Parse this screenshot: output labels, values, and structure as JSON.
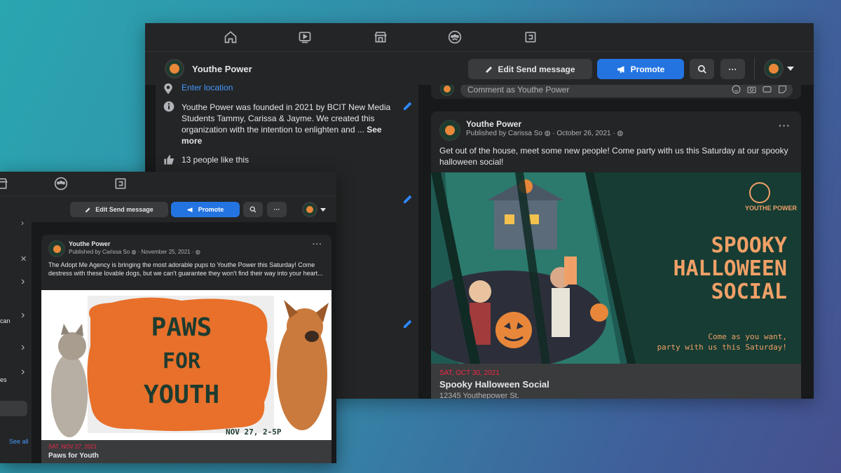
{
  "colors": {
    "fb_blue": "#2374e1",
    "bg_dark": "#18191a",
    "card": "#242526",
    "link": "#4599ff",
    "event_date": "#f02849",
    "event_bg": "#163c33",
    "event_title": "#f0a067"
  },
  "nav_icons": [
    "home-icon",
    "watch-icon",
    "marketplace-icon",
    "groups-icon",
    "gaming-icon"
  ],
  "page": {
    "name": "Youthe Power"
  },
  "buttons": {
    "edit_send": "Edit Send message",
    "promote": "Promote"
  },
  "about": {
    "location": "Enter location",
    "description": "Youthe Power was founded in 2021 by BCIT New Media Students Tammy, Carissa & Jayme. We created this organization with the intention to enlighten and ...",
    "see_more": "See more",
    "likes": "13 people like this"
  },
  "comment_placeholder": "Comment as Youthe Power",
  "post_main": {
    "author": "Youthe Power",
    "meta": "Published by Carissa So",
    "date": "October 26, 2021",
    "body": "Get out of the house, meet some new people! Come party with us this Saturday at our spooky halloween social!",
    "image": {
      "brand": "YOUTHE POWER",
      "title_lines": [
        "SPOOKY",
        "HALLOWEEN",
        "SOCIAL"
      ],
      "sub_lines": [
        "Come as you want,",
        "party with us this Saturday!"
      ]
    },
    "event_date": "SAT, OCT 30, 2021",
    "event_title": "Spooky Halloween Social",
    "event_address": "12345 Youthepower St."
  },
  "post_second": {
    "author": "Youthe Power",
    "meta": "Published by Carissa So",
    "date": "November 25, 2021",
    "body": "The Adopt Me Agency is bringing the most adorable pups to Youthe Power this Saturday! Come destress with these lovable dogs, but we can't guarantee they won't find their way into your heart...",
    "image": {
      "title_lines": [
        "PAWS",
        "FOR",
        "YOUTH"
      ],
      "date_text": "NOV 27, 2-5P"
    },
    "event_date": "SAT, NOV 27, 2021",
    "event_title": "Paws for Youth"
  },
  "second_left": {
    "fragment_1": "can",
    "fragment_2": "es",
    "see_all": "See all"
  }
}
